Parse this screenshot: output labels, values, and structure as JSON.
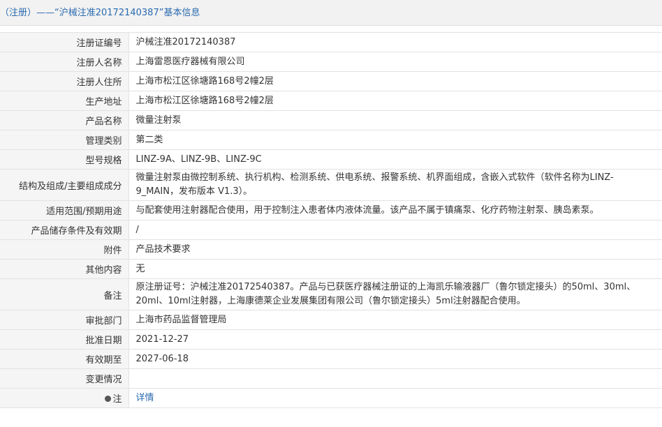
{
  "header": {
    "title": "（注册）——“沪械注准20172140387”基本信息"
  },
  "rows": [
    {
      "label": "注册证编号",
      "value": "沪械注准20172140387"
    },
    {
      "label": "注册人名称",
      "value": "上海雷恩医疗器械有限公司"
    },
    {
      "label": "注册人住所",
      "value": "上海市松江区徐塘路168号2幢2层"
    },
    {
      "label": "生产地址",
      "value": "上海市松江区徐塘路168号2幢2层"
    },
    {
      "label": "产品名称",
      "value": "微量注射泵"
    },
    {
      "label": "管理类别",
      "value": "第二类"
    },
    {
      "label": "型号规格",
      "value": "LINZ-9A、LINZ-9B、LINZ-9C"
    },
    {
      "label": "结构及组成/主要组成成分",
      "value": "微量注射泵由微控制系统、执行机构、检测系统、供电系统、报警系统、机界面组成，含嵌入式软件（软件名称为LINZ-9_MAIN，发布版本 V1.3）。"
    },
    {
      "label": "适用范围/预期用途",
      "value": "与配套使用注射器配合使用，用于控制注入患者体内液体流量。该产品不属于镇痛泵、化疗药物注射泵、胰岛素泵。"
    },
    {
      "label": "产品储存条件及有效期",
      "value": "/"
    },
    {
      "label": "附件",
      "value": "产品技术要求"
    },
    {
      "label": "其他内容",
      "value": "无"
    },
    {
      "label": "备注",
      "value": "原注册证号：沪械注准20172540387。产品与已获医疗器械注册证的上海凯乐输液器厂（鲁尔锁定接头）的50ml、30ml、20ml、10ml注射器，上海康德莱企业发展集团有限公司（鲁尔锁定接头）5ml注射器配合使用。"
    },
    {
      "label": "审批部门",
      "value": "上海市药品监督管理局"
    },
    {
      "label": "批准日期",
      "value": "2021-12-27"
    },
    {
      "label": "有效期至",
      "value": "2027-06-18"
    },
    {
      "label": "变更情况",
      "value": ""
    }
  ],
  "note_row": {
    "label": "注",
    "icon": "pin-icon",
    "link": "详情"
  }
}
